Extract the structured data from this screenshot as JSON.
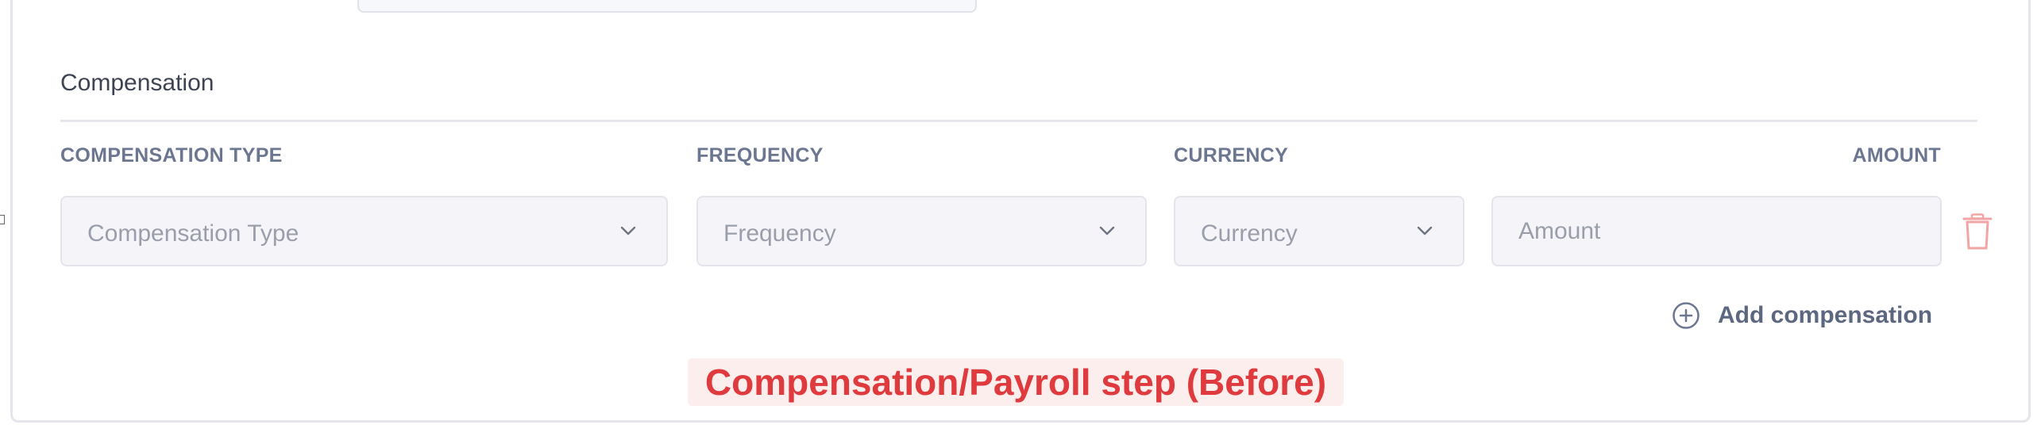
{
  "compensation": {
    "section_title": "Compensation",
    "columns": {
      "type": "COMPENSATION TYPE",
      "frequency": "FREQUENCY",
      "currency": "CURRENCY",
      "amount": "AMOUNT"
    },
    "row": {
      "type_placeholder": "Compensation Type",
      "frequency_placeholder": "Frequency",
      "currency_placeholder": "Currency",
      "amount_placeholder": "Amount"
    },
    "add_label": "Add compensation"
  },
  "caption": "Compensation/Payroll step (Before)",
  "colors": {
    "label": "#6b7690",
    "placeholder": "#9a9eab",
    "field_bg": "#f5f5f9",
    "delete": "#f2a5a5",
    "caption_text": "#df3a3e",
    "caption_bg": "#fdeeee"
  },
  "icons": {
    "dropdown": "chevron-down-icon",
    "delete": "trash-icon",
    "add": "plus-circle-icon"
  }
}
